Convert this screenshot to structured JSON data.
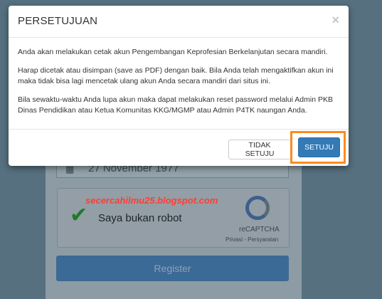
{
  "modal": {
    "title": "PERSETUJUAN",
    "close_icon": "×",
    "paragraphs": [
      "Anda akan melakukan cetak akun Pengembangan Keprofesian Berkelanjutan secara mandiri.",
      "Harap dicetak atau disimpan (save as PDF) dengan baik. Bila Anda telah mengaktifkan akun ini maka tidak bisa lagi mencetak ulang akun Anda secara mandiri dari situs ini.",
      "Bila sewaktu-waktu Anda lupa akun maka dapat melakukan reset password melalui Admin PKB Dinas Pendidikan atau Ketua Komunitas KKG/MGMP atau Admin P4TK naungan Anda."
    ],
    "cancel_label": "TIDAK SETUJU",
    "agree_label": "SETUJU"
  },
  "form": {
    "date_value": "27 November 1977",
    "recaptcha_label": "Saya bukan robot",
    "recaptcha_name": "reCAPTCHA",
    "recaptcha_terms": "Privasi - Persyaratan",
    "register_label": "Register"
  },
  "watermark": "secercahilmu25.blogspot.com",
  "colors": {
    "primary": "#337ab7",
    "highlight": "#ff8a1e",
    "watermark": "#ff3e33"
  }
}
